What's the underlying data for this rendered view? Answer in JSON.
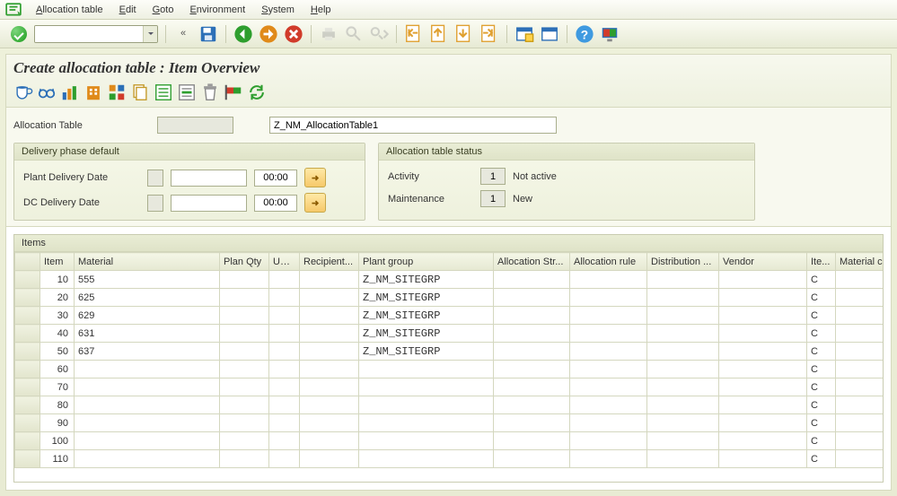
{
  "menu": {
    "items": [
      {
        "pre": "A",
        "rest": "llocation table"
      },
      {
        "pre": "E",
        "rest": "dit"
      },
      {
        "pre": "G",
        "rest": "oto"
      },
      {
        "pre": "E",
        "rest": "nvironment"
      },
      {
        "pre": "S",
        "rest": "ystem"
      },
      {
        "pre": "H",
        "rest": "elp"
      }
    ]
  },
  "page": {
    "title": "Create allocation table : Item Overview"
  },
  "header": {
    "alloc_label": "Allocation Table",
    "alloc_code": "",
    "alloc_name": "Z_NM_AllocationTable1"
  },
  "delivery_box": {
    "legend": "Delivery phase default",
    "plant_label": "Plant Delivery Date",
    "plant_date": "",
    "plant_time": "00:00",
    "dc_label": "DC Delivery Date",
    "dc_date": "",
    "dc_time": "00:00"
  },
  "status_box": {
    "legend": "Allocation table status",
    "activity_label": "Activity",
    "activity_code": "1",
    "activity_text": "Not active",
    "maint_label": "Maintenance",
    "maint_code": "1",
    "maint_text": "New"
  },
  "items_box": {
    "legend": "Items"
  },
  "columns": {
    "item": "Item",
    "material": "Material",
    "planqty": "Plan Qty",
    "uni": "Uni...",
    "recipient": "Recipient...",
    "plantgroup": "Plant group",
    "allocstr": "Allocation Str...",
    "allocrule": "Allocation rule",
    "dist": "Distribution ...",
    "vendor": "Vendor",
    "ite": "Ite...",
    "matc": "Material c"
  },
  "rows": [
    {
      "item": "10",
      "material": "555",
      "plantgroup": "Z_NM_SITEGRP",
      "ite": "C"
    },
    {
      "item": "20",
      "material": "625",
      "plantgroup": "Z_NM_SITEGRP",
      "ite": "C"
    },
    {
      "item": "30",
      "material": "629",
      "plantgroup": "Z_NM_SITEGRP",
      "ite": "C"
    },
    {
      "item": "40",
      "material": "631",
      "plantgroup": "Z_NM_SITEGRP",
      "ite": "C"
    },
    {
      "item": "50",
      "material": "637",
      "plantgroup": "Z_NM_SITEGRP",
      "ite": "C"
    },
    {
      "item": "60",
      "material": "",
      "plantgroup": "",
      "ite": "C"
    },
    {
      "item": "70",
      "material": "",
      "plantgroup": "",
      "ite": "C"
    },
    {
      "item": "80",
      "material": "",
      "plantgroup": "",
      "ite": "C"
    },
    {
      "item": "90",
      "material": "",
      "plantgroup": "",
      "ite": "C"
    },
    {
      "item": "100",
      "material": "",
      "plantgroup": "",
      "ite": "C"
    },
    {
      "item": "110",
      "material": "",
      "plantgroup": "",
      "ite": "C"
    }
  ]
}
